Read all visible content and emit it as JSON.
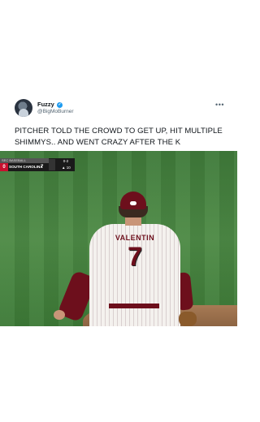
{
  "tweet": {
    "display_name": "Fuzzy",
    "handle": "@BigMoBurner",
    "more_icon": "more-horizontal-icon",
    "text": "PITCHER TOLD THE CROWD TO GET UP, HIT MULTIPLE SHIMMYS.. AND WENT CRAZY AFTER THE K"
  },
  "video": {
    "scorebug": {
      "network": "SEC BASEBALL",
      "team_rank": "0",
      "team": "SOUTH CAROLINA",
      "runs": "7",
      "count": "0-2",
      "inning": "▲ 10"
    },
    "player": {
      "jersey_name": "VALENTIN",
      "jersey_number": "7"
    }
  },
  "colors": {
    "verified": "#1d9bf0",
    "gamecock_garnet": "#6d0f1c",
    "field_green": "#4d8a45"
  }
}
